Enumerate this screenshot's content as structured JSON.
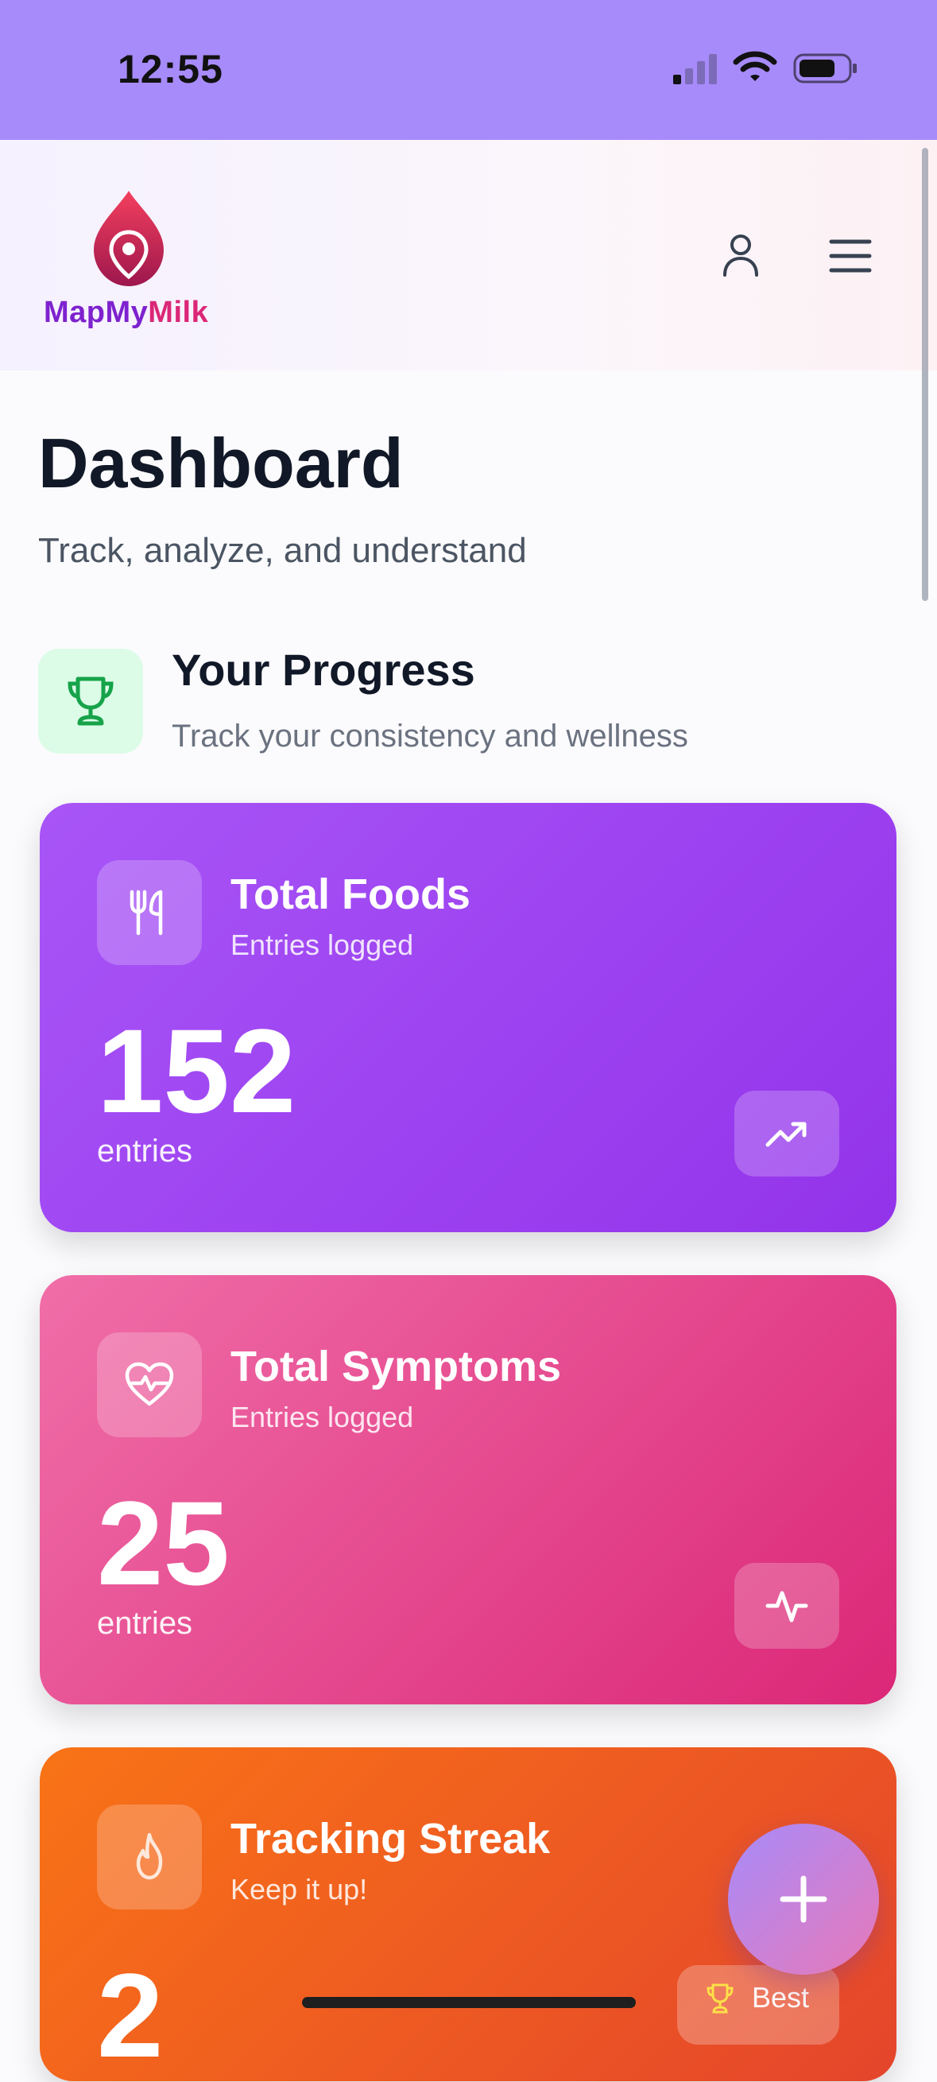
{
  "status_bar": {
    "time": "12:55"
  },
  "header": {
    "logo_text_part1": "MapMy",
    "logo_text_part2": "Milk",
    "icons": [
      "map-pin-logo-icon",
      "user-icon",
      "hamburger-menu-icon"
    ]
  },
  "page": {
    "title": "Dashboard",
    "subtitle": "Track, analyze, and understand"
  },
  "progress_section": {
    "title": "Your Progress",
    "subtitle": "Track your consistency and wellness",
    "icon": "trophy-icon"
  },
  "cards": [
    {
      "title": "Total Foods",
      "subtitle": "Entries logged",
      "value": "152",
      "unit": "entries",
      "icon": "utensils-icon",
      "trend_icon": "trending-up-icon",
      "color": "#9333ea"
    },
    {
      "title": "Total Symptoms",
      "subtitle": "Entries logged",
      "value": "25",
      "unit": "entries",
      "icon": "heart-pulse-icon",
      "trend_icon": "activity-icon",
      "color": "#db2777"
    },
    {
      "title": "Tracking Streak",
      "subtitle": "Keep it up!",
      "value": "2",
      "icon": "flame-icon",
      "badge_label": "Best",
      "color": "#f97316"
    }
  ],
  "fab": {
    "icon": "plus-icon"
  }
}
